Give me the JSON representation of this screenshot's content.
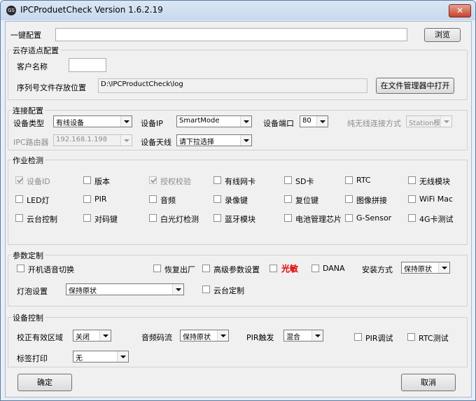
{
  "window": {
    "title": "IPCProduetCheck Version 1.6.2.19",
    "icon": "app-icon",
    "close": "✕"
  },
  "one_key": {
    "label": "一键配置",
    "value": "",
    "browse": "浏览"
  },
  "cloud": {
    "title": "云存适点配置",
    "customer_label": "客户名称",
    "customer_value": "",
    "path_label": "序列号文件存放位置",
    "path_value": "D:\\IPCProductCheck\\log",
    "open_button": "在文件管理器中打开"
  },
  "connect": {
    "title": "连接配置",
    "type_label": "设备类型",
    "type_value": "有线设备",
    "ip_label": "设备IP",
    "ip_value": "SmartMode",
    "port_label": "设备端口",
    "port_value": "80",
    "wifi_label": "纯无线连接方式",
    "wifi_value": "Station模",
    "router_label": "IPC路由器",
    "router_value": "192.168.1.198",
    "antenna_label": "设备天线",
    "antenna_value": "请下拉选择"
  },
  "jobs": {
    "title": "作业检测",
    "items": [
      {
        "label": "设备ID",
        "checked": true,
        "disabled": true
      },
      {
        "label": "版本",
        "checked": false,
        "disabled": false
      },
      {
        "label": "授权校验",
        "checked": true,
        "disabled": true
      },
      {
        "label": "有线网卡",
        "checked": false,
        "disabled": false
      },
      {
        "label": "SD卡",
        "checked": false,
        "disabled": false
      },
      {
        "label": "RTC",
        "checked": false,
        "disabled": false
      },
      {
        "label": "无线模块",
        "checked": false,
        "disabled": false
      },
      {
        "label": "LED灯",
        "checked": false,
        "disabled": false
      },
      {
        "label": "PIR",
        "checked": false,
        "disabled": false
      },
      {
        "label": "音频",
        "checked": false,
        "disabled": false
      },
      {
        "label": "录像键",
        "checked": false,
        "disabled": false
      },
      {
        "label": "复位键",
        "checked": false,
        "disabled": false
      },
      {
        "label": "图像拼接",
        "checked": false,
        "disabled": false
      },
      {
        "label": "WiFi Mac",
        "checked": false,
        "disabled": false
      },
      {
        "label": "云台控制",
        "checked": false,
        "disabled": false
      },
      {
        "label": "对码键",
        "checked": false,
        "disabled": false
      },
      {
        "label": "白光灯检测",
        "checked": false,
        "disabled": false
      },
      {
        "label": "蓝牙模块",
        "checked": false,
        "disabled": false
      },
      {
        "label": "电池管理芯片",
        "checked": false,
        "disabled": false
      },
      {
        "label": "G-Sensor",
        "checked": false,
        "disabled": false
      },
      {
        "label": "4G卡测试",
        "checked": false,
        "disabled": false
      }
    ]
  },
  "params": {
    "title": "参数定制",
    "voice_switch": "开机语音切换",
    "factory_reset": "恢复出厂",
    "advanced": "高级参数设置",
    "light_sense": "光敏",
    "dana": "DANA",
    "install_label": "安装方式",
    "install_value": "保持原状",
    "bulb_label": "灯泡设置",
    "bulb_value": "保持原状",
    "ptz_custom": "云台定制"
  },
  "device_ctrl": {
    "title": "设备控制",
    "region_label": "校正有效区域",
    "region_value": "关闭",
    "audio_label": "音频码流",
    "audio_value": "保持原状",
    "pir_label": "PIR触发",
    "pir_value": "混合",
    "pir_debug": "PIR调试",
    "rtc_test": "RTC测试",
    "print_label": "标签打印",
    "print_value": "无"
  },
  "footer": {
    "ok": "确定",
    "cancel": "取消"
  },
  "colors": {
    "accent_red": "#e00000",
    "title_bar": "#c7d8ee",
    "close": "#c7432d"
  }
}
